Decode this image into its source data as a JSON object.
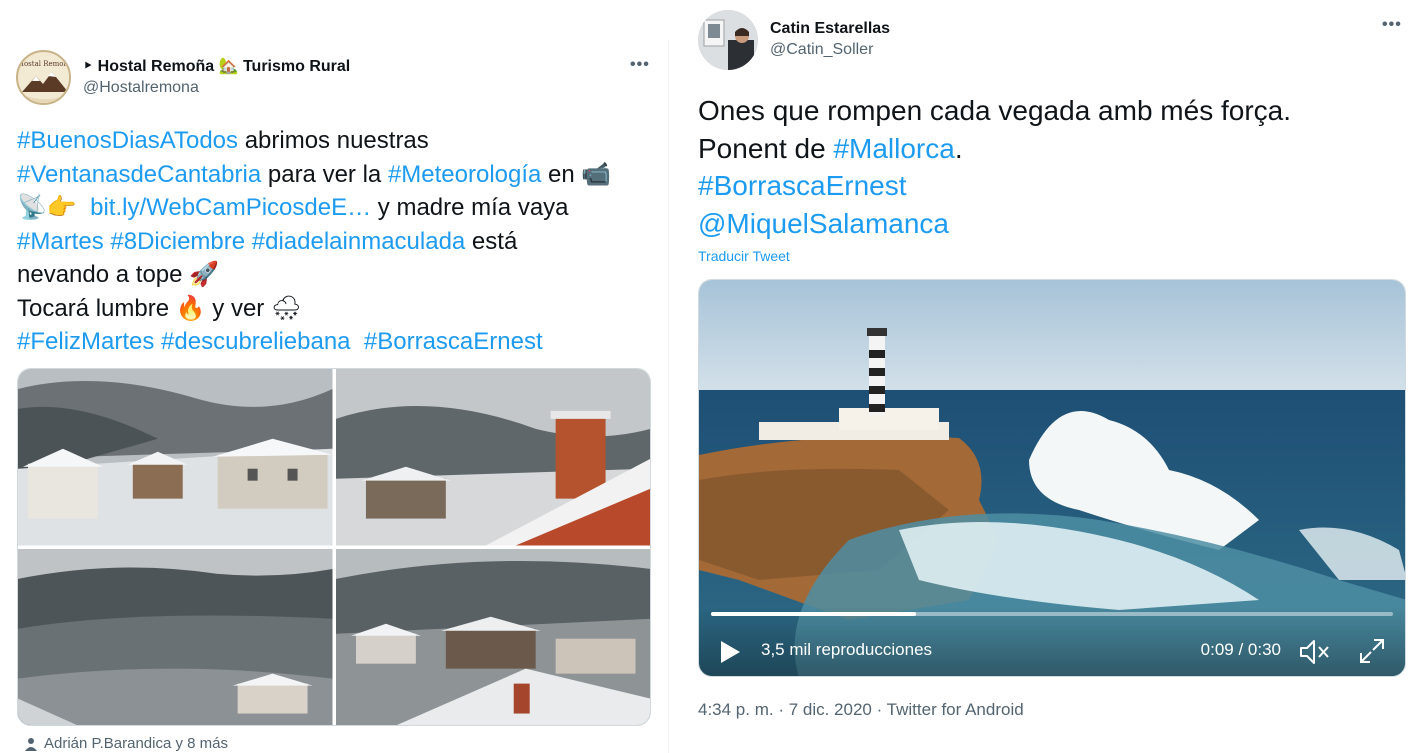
{
  "left_tweet": {
    "display_name": "‣ Hostal Remoña 🏡 Turismo Rural",
    "handle": "@Hostalremona",
    "avatar_text": "Hostal Remoña",
    "more": "•••",
    "lines": [
      [
        {
          "t": "#BuenosDiasATodos",
          "h": true
        },
        {
          "t": " abrimos nuestras",
          "h": false
        }
      ],
      [
        {
          "t": "#VentanasdeCantabria",
          "h": true
        },
        {
          "t": " para ver la ",
          "h": false
        },
        {
          "t": "#Meteorología",
          "h": true
        },
        {
          "t": " en 📹",
          "h": false
        }
      ],
      [
        {
          "t": "📡👉  ",
          "h": false
        },
        {
          "t": "bit.ly/WebCamPicosdeE…",
          "h": true
        },
        {
          "t": " y madre mía vaya",
          "h": false
        }
      ],
      [
        {
          "t": "#Martes",
          "h": true
        },
        {
          "t": " ",
          "h": false
        },
        {
          "t": "#8Diciembre",
          "h": true
        },
        {
          "t": " ",
          "h": false
        },
        {
          "t": "#diadelainmaculada",
          "h": true
        },
        {
          "t": " está",
          "h": false
        }
      ],
      [
        {
          "t": "nevando a tope 🚀",
          "h": false
        }
      ],
      [
        {
          "t": "Tocará lumbre 🔥 y ver 🌨",
          "h": false
        }
      ],
      [
        {
          "t": "#FelizMartes",
          "h": true
        },
        {
          "t": " ",
          "h": false
        },
        {
          "t": "#descubreliebana",
          "h": true
        },
        {
          "t": "  ",
          "h": false
        },
        {
          "t": "#BorrascaErnest",
          "h": true
        }
      ]
    ],
    "liked_by": "Adrián P.Barandica y 8 más"
  },
  "right_tweet": {
    "display_name": "Catin Estarellas",
    "handle": "@Catin_Soller",
    "more": "•••",
    "lines": [
      [
        {
          "t": "Ones que rompen cada vegada amb més força.",
          "h": false
        }
      ],
      [
        {
          "t": "Ponent de ",
          "h": false
        },
        {
          "t": "#Mallorca",
          "h": true
        },
        {
          "t": ".",
          "h": false
        }
      ],
      [
        {
          "t": "#BorrascaErnest",
          "h": true
        }
      ],
      [
        {
          "t": "@MiquelSalamanca",
          "h": true
        }
      ]
    ],
    "translate": "Traducir Tweet",
    "video": {
      "views": "3,5 mil reproducciones",
      "time": "0:09 / 0:30",
      "progress": 0.3
    },
    "meta": "4:34 p. m. · 7 dic. 2020 · Twitter for Android"
  },
  "colors": {
    "link": "#1d9bf0",
    "text": "#0f1419",
    "secondary": "#536471"
  }
}
